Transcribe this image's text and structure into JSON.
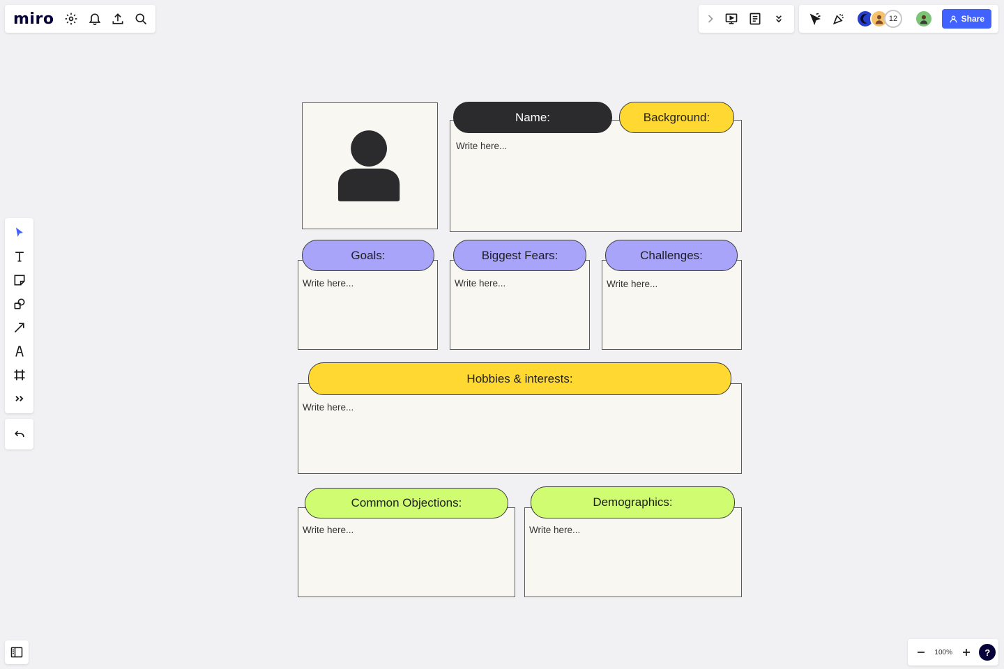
{
  "app": {
    "logo": "miro"
  },
  "topbar": {
    "collaborator_count": "12",
    "share_label": "Share"
  },
  "zoom": {
    "level": "100%",
    "help": "?"
  },
  "board": {
    "name_label": "Name:",
    "background_label": "Background:",
    "goals_label": "Goals:",
    "fears_label": "Biggest Fears:",
    "challenges_label": "Challenges:",
    "hobbies_label": "Hobbies & interests:",
    "objections_label": "Common Objections:",
    "demographics_label": "Demographics:",
    "placeholder": "Write here..."
  },
  "colors": {
    "accent": "#4262ff",
    "yellow": "#ffd932",
    "purple": "#a7a4fa",
    "green": "#cffc71",
    "dark": "#2b2b2d",
    "card": "#f9f7f1"
  },
  "icons": {
    "topleft": [
      "settings-icon",
      "bell-icon",
      "upload-icon",
      "search-icon"
    ],
    "topcenter": [
      "chevron-right-icon",
      "presentation-icon",
      "notes-icon",
      "double-chevron-down-icon"
    ],
    "topright": [
      "cursor-icon",
      "celebration-icon"
    ],
    "lefttools": [
      "select-icon",
      "text-icon",
      "sticky-note-icon",
      "shapes-icon",
      "arrow-icon",
      "pen-icon",
      "frame-icon",
      "more-tools-icon"
    ]
  }
}
